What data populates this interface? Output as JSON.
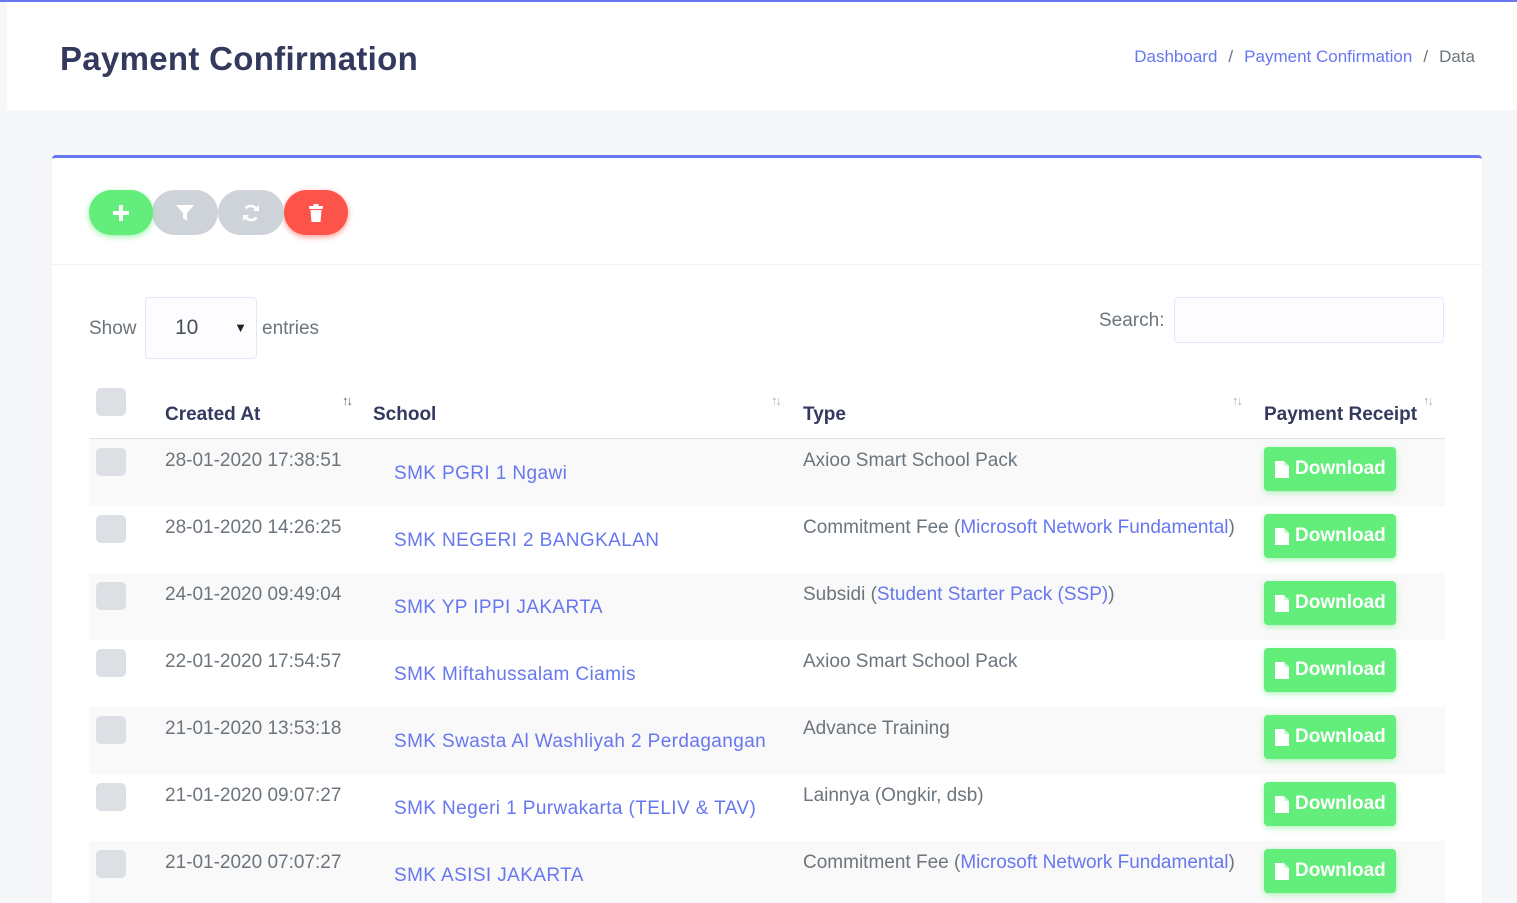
{
  "header": {
    "title": "Payment Confirmation",
    "breadcrumb": [
      "Dashboard",
      "Payment Confirmation",
      "Data"
    ],
    "breadcrumb_sep": "/"
  },
  "toolbar": {
    "buttons": [
      {
        "name": "add-button",
        "icon": "plus-icon",
        "color": "#63ed7a"
      },
      {
        "name": "filter-button",
        "icon": "filter-icon",
        "color": "#cdd3d8"
      },
      {
        "name": "refresh-button",
        "icon": "refresh-icon",
        "color": "#cdd3d8"
      },
      {
        "name": "delete-button",
        "icon": "trash-icon",
        "color": "#fc544b"
      }
    ]
  },
  "controls": {
    "show_label": "Show",
    "entries_value": "10",
    "entries_label": "entries",
    "search_label": "Search:",
    "search_value": ""
  },
  "table": {
    "columns": [
      "Created At",
      "School",
      "Type",
      "Payment Receipt"
    ],
    "download_label": "Download",
    "rows": [
      {
        "created_at": "28-01-2020 17:38:51",
        "school": "SMK PGRI 1 Ngawi",
        "type": "Axioo Smart School Pack",
        "type_link": "",
        "type_suffix": ""
      },
      {
        "created_at": "28-01-2020 14:26:25",
        "school": "SMK NEGERI 2 BANGKALAN",
        "type": "Commitment Fee (",
        "type_link": "Microsoft Network Fundamental",
        "type_suffix": ")"
      },
      {
        "created_at": "24-01-2020 09:49:04",
        "school": "SMK YP IPPI JAKARTA",
        "type": "Subsidi (",
        "type_link": "Student Starter Pack (SSP)",
        "type_suffix": ")"
      },
      {
        "created_at": "22-01-2020 17:54:57",
        "school": "SMK Miftahussalam Ciamis",
        "type": "Axioo Smart School Pack",
        "type_link": "",
        "type_suffix": ""
      },
      {
        "created_at": "21-01-2020 13:53:18",
        "school": "SMK Swasta Al Washliyah 2 Perdagangan",
        "type": "Advance Training",
        "type_link": "",
        "type_suffix": ""
      },
      {
        "created_at": "21-01-2020 09:07:27",
        "school": "SMK Negeri 1 Purwakarta (TELIV & TAV)",
        "type": "Lainnya (Ongkir, dsb)",
        "type_link": "",
        "type_suffix": ""
      },
      {
        "created_at": "21-01-2020 07:07:27",
        "school": "SMK ASISI JAKARTA",
        "type": "Commitment Fee (",
        "type_link": "Microsoft Network Fundamental",
        "type_suffix": ")"
      }
    ]
  },
  "colors": {
    "primary": "#6777ef",
    "success": "#63ed7a",
    "danger": "#fc544b",
    "secondary": "#cdd3d8"
  }
}
